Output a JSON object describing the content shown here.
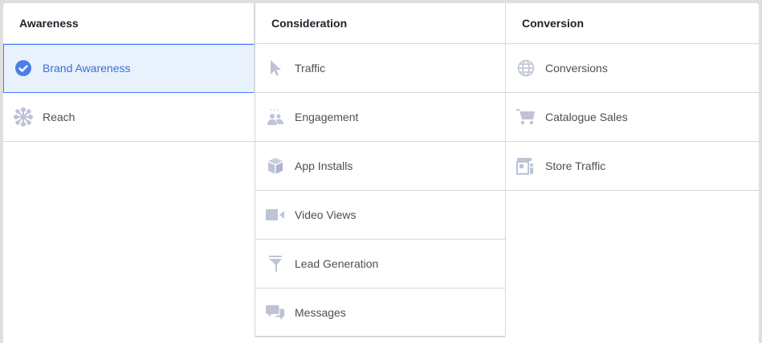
{
  "columns": [
    {
      "title": "Awareness",
      "items": [
        {
          "label": "Brand Awareness",
          "icon": "check-circle-icon",
          "selected": true
        },
        {
          "label": "Reach",
          "icon": "reach-icon"
        }
      ]
    },
    {
      "title": "Consideration",
      "items": [
        {
          "label": "Traffic",
          "icon": "cursor-icon"
        },
        {
          "label": "Engagement",
          "icon": "people-icon"
        },
        {
          "label": "App Installs",
          "icon": "box-icon"
        },
        {
          "label": "Video Views",
          "icon": "video-camera-icon"
        },
        {
          "label": "Lead Generation",
          "icon": "funnel-icon"
        },
        {
          "label": "Messages",
          "icon": "chat-bubbles-icon"
        }
      ]
    },
    {
      "title": "Conversion",
      "items": [
        {
          "label": "Conversions",
          "icon": "globe-icon"
        },
        {
          "label": "Catalogue Sales",
          "icon": "cart-icon"
        },
        {
          "label": "Store Traffic",
          "icon": "store-icon"
        }
      ]
    }
  ],
  "colors": {
    "accent": "#4080ff",
    "icon": "#bec3d6",
    "selected_bg": "#e9f2fc"
  }
}
